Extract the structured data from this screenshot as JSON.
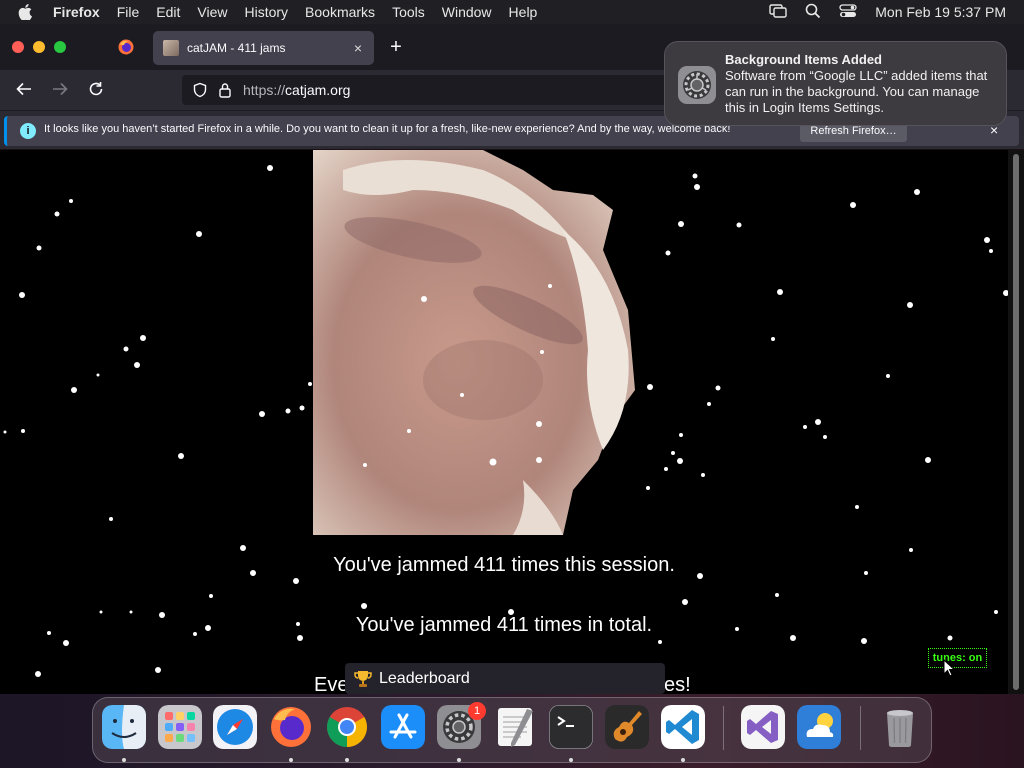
{
  "menubar": {
    "apple_icon": "apple-icon",
    "app_name": "Firefox",
    "menus": [
      "File",
      "Edit",
      "View",
      "History",
      "Bookmarks",
      "Tools",
      "Window",
      "Help"
    ],
    "status_icons": [
      "screen-mirroring-icon",
      "spotlight-search-icon",
      "control-center-icon"
    ],
    "clock": "Mon Feb 19  5:37 PM"
  },
  "browser": {
    "tab_title": "catJAM - 411 jams",
    "tab_close": "×",
    "new_tab": "+",
    "url_scheme": "https://",
    "url_host": "catjam.org",
    "notification_bar": {
      "message": "It looks like you haven’t started Firefox in a while. Do you want to clean it up for a fresh, like-new experience? And by the way, welcome back!",
      "info_glyph": "i",
      "button": "Refresh Firefox…",
      "close": "×"
    }
  },
  "page": {
    "session_text": "You've jammed 411 times this session.",
    "total_text": "You've jammed 411 times in total.",
    "everyone_text": "Eve",
    "everyone_text_end": "es!",
    "tunes_toggle": "tunes: on",
    "leaderboard_label": "Leaderboard"
  },
  "notification": {
    "title": "Background Items Added",
    "body": "Software from “Google LLC” added items that can run in the background. You can manage this in Login Items Settings."
  },
  "dock": {
    "apps": [
      "Finder",
      "Launchpad",
      "Safari",
      "Firefox",
      "Google Chrome",
      "App Store",
      "System Settings",
      "TextEdit",
      "Terminal",
      "GarageBand",
      "Visual Studio Code",
      "Visual Studio",
      "Weather",
      "Trash"
    ],
    "system_settings_badge": "1"
  },
  "colors": {
    "accent_blue": "#0090ed",
    "tunes_green": "#39ff14",
    "badge_red": "#ff3b30"
  }
}
